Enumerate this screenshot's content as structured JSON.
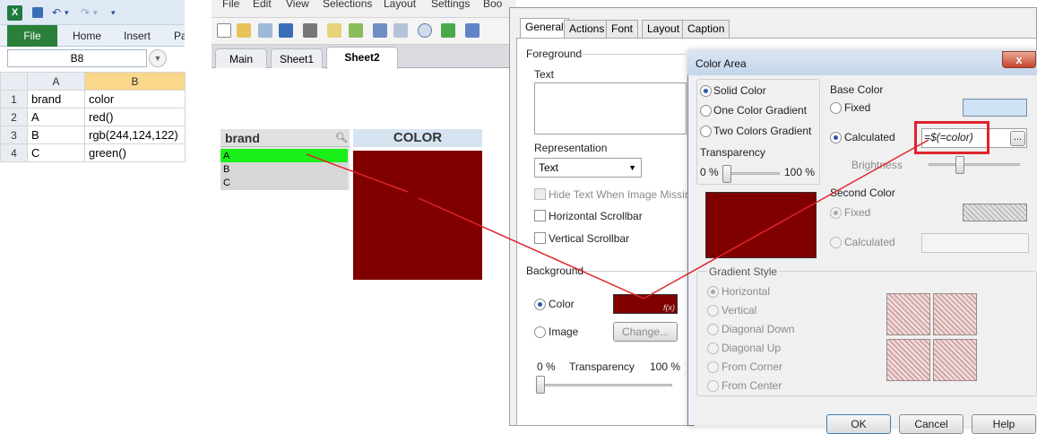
{
  "excel": {
    "logo": "X",
    "qat": {
      "undo": "↶",
      "redo": "↷",
      "dropdown": "▾"
    },
    "ribbon_tabs": [
      {
        "label": "File"
      },
      {
        "label": "Home"
      },
      {
        "label": "Insert"
      },
      {
        "label": "Pa"
      }
    ],
    "name_box": "B8",
    "col_headers": [
      "A",
      "B"
    ],
    "rows": [
      {
        "num": "1",
        "a": "brand",
        "b": "color"
      },
      {
        "num": "2",
        "a": "A",
        "b": "red()"
      },
      {
        "num": "3",
        "a": "B",
        "b": "rgb(244,124,122)"
      },
      {
        "num": "4",
        "a": "C",
        "b": "green()"
      }
    ]
  },
  "qlikview": {
    "menu": [
      "File",
      "Edit",
      "View",
      "Selections",
      "Layout",
      "Settings",
      "Boo"
    ],
    "tabs": [
      {
        "label": "Main"
      },
      {
        "label": "Sheet1"
      },
      {
        "label": "Sheet2"
      }
    ],
    "listbox": {
      "title": "brand",
      "items": [
        {
          "label": "A",
          "state": "selected"
        },
        {
          "label": "B",
          "state": "excluded"
        },
        {
          "label": "C",
          "state": "excluded"
        }
      ]
    },
    "text_object": {
      "title": "COLOR",
      "fill_color": "#800000"
    }
  },
  "properties_dialog": {
    "tabs": [
      {
        "label": "General"
      },
      {
        "label": "Actions"
      },
      {
        "label": "Font"
      },
      {
        "label": "Layout"
      },
      {
        "label": "Caption"
      }
    ],
    "foreground_label": "Foreground",
    "text_label": "Text",
    "representation_label": "Representation",
    "representation_value": "Text",
    "checkboxes": [
      {
        "label": "Hide Text When Image Missing",
        "enabled": false
      },
      {
        "label": "Horizontal Scrollbar",
        "enabled": true
      },
      {
        "label": "Vertical Scrollbar",
        "enabled": true
      }
    ],
    "background_label": "Background",
    "bg_color_label": "Color",
    "bg_image_label": "Image",
    "fx_label": "f(x)",
    "change_button": "Change...",
    "transparency_min": "0 %",
    "transparency_label": "Transparency",
    "transparency_max": "100 %",
    "transparency_level": 0
  },
  "color_area_dialog": {
    "title": "Color Area",
    "close_glyph": "x",
    "fill_modes": [
      {
        "label": "Solid Color",
        "checked": true
      },
      {
        "label": "One Color Gradient",
        "checked": false
      },
      {
        "label": "Two Colors Gradient",
        "checked": false
      }
    ],
    "transparency_label": "Transparency",
    "transparency_min": "0 %",
    "transparency_max": "100 %",
    "transparency_level": 0,
    "base_color_label": "Base Color",
    "fixed_label": "Fixed",
    "calculated_label": "Calculated",
    "formula": "=$(=color)",
    "ellipsis": "...",
    "brightness_label": "Brightness",
    "second_color_label": "Second Color",
    "second_fixed_label": "Fixed",
    "second_calculated_label": "Calculated",
    "preview_color": "#800000",
    "gradient_style_label": "Gradient Style",
    "gradient_styles": [
      {
        "label": "Horizontal",
        "checked": true
      },
      {
        "label": "Vertical",
        "checked": false
      },
      {
        "label": "Diagonal Down",
        "checked": false
      },
      {
        "label": "Diagonal Up",
        "checked": false
      },
      {
        "label": "From Corner",
        "checked": false
      },
      {
        "label": "From Center",
        "checked": false
      }
    ],
    "buttons": {
      "ok": "OK",
      "cancel": "Cancel",
      "help": "Help"
    }
  },
  "colors": {
    "selected_green": "#19f019",
    "maroon": "#800000",
    "annotation_red": "#e0232b"
  }
}
